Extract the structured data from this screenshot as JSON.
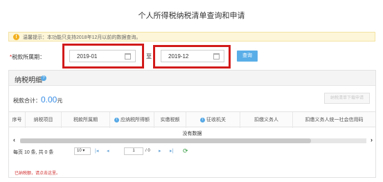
{
  "page": {
    "title": "个人所得税纳税清单查询和申请"
  },
  "tip": {
    "icon": "info-icon",
    "text": "温馨提示：本功能只支持2018年12月以前的数据查询。"
  },
  "query": {
    "required_mark": "*",
    "period_label": "税款所属期：",
    "start_value": "2019-01",
    "to_label": "至",
    "end_value": "2019-12",
    "button_label": "查询",
    "accent_color": "#5aaee8",
    "highlight_color": "#d21a1a"
  },
  "details": {
    "title": "纳税明细",
    "total_label": "税款合计：",
    "total_amount": "0.00",
    "total_unit": "元",
    "export_button": "纳税清单下载申请",
    "columns": [
      {
        "label": "序号",
        "info": false
      },
      {
        "label": "纳税项目",
        "info": false
      },
      {
        "label": "税款所属期",
        "info": false
      },
      {
        "label": "应纳税所得额",
        "info": true
      },
      {
        "label": "实缴税额",
        "info": false
      },
      {
        "label": "征收机关",
        "info": true
      },
      {
        "label": "扣缴义务人",
        "info": false
      },
      {
        "label": "扣缴义务人统一社会信用码",
        "info": false
      }
    ],
    "empty_text": "没有数据"
  },
  "pager": {
    "info": "每页 10 条, 共 0 条",
    "page_size": "10",
    "current_page": "1",
    "total_pages": "/ 0"
  },
  "footnote": "已纳税额，请点击这里。"
}
